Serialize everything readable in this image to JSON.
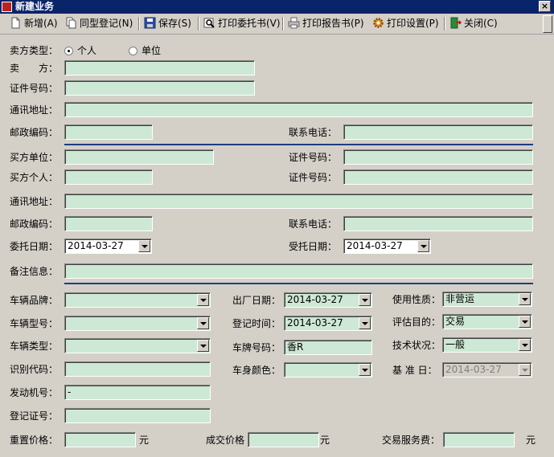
{
  "window": {
    "title": "新建业务"
  },
  "toolbar": {
    "add": "新增(A)",
    "same_register": "同型登记(N)",
    "save": "保存(S)",
    "print_commission": "打印委托书(V)",
    "print_report": "打印报告书(P)",
    "print_settings": "打印设置(P)",
    "close": "关闭(C)"
  },
  "seller": {
    "type_label": "卖方类型：",
    "type_options": [
      "个人",
      "单位"
    ],
    "type_selected": "个人",
    "name_label": "卖　　方：",
    "name_value": "",
    "id_label": "证件号码：",
    "id_value": "",
    "address_label": "通讯地址：",
    "address_value": "",
    "postal_label": "邮政编码：",
    "postal_value": "",
    "phone_label": "联系电话：",
    "phone_value": ""
  },
  "buyer": {
    "unit_label": "买方单位：",
    "unit_value": "",
    "unit_id_label": "证件号码：",
    "unit_id_value": "",
    "person_label": "买方个人：",
    "person_value": "",
    "person_id_label": "证件号码：",
    "person_id_value": "",
    "address_label": "通讯地址：",
    "address_value": "",
    "postal_label": "邮政编码：",
    "postal_value": "",
    "phone_label": "联系电话：",
    "phone_value": "",
    "commission_date_label": "委托日期：",
    "commission_date_value": "2014-03-27",
    "accept_date_label": "受托日期：",
    "accept_date_value": "2014-03-27",
    "remarks_label": "备注信息：",
    "remarks_value": ""
  },
  "vehicle": {
    "brand_label": "车辆品牌：",
    "brand_value": "",
    "factory_date_label": "出厂日期：",
    "factory_date_value": "2014-03-27",
    "usage_label": "使用性质：",
    "usage_value": "非营运",
    "model_label": "车辆型号：",
    "model_value": "",
    "register_time_label": "登记时间：",
    "register_time_value": "2014-03-27",
    "purpose_label": "评估目的：",
    "purpose_value": "交易",
    "type_label": "车辆类型：",
    "type_value": "",
    "plate_label": "车牌号码：",
    "plate_value": "香R",
    "condition_label": "技术状况：",
    "condition_value": "一般",
    "vin_label": "识别代码：",
    "vin_value": "",
    "color_label": "车身颜色：",
    "color_value": "",
    "base_date_label": "基 准 日：",
    "base_date_value": "2014-03-27",
    "engine_label": "发动机号：",
    "engine_value": "-",
    "cert_label": "登记证号：",
    "cert_value": "",
    "reset_price_label": "重置价格：",
    "reset_price_value": "",
    "deal_price_label": "成交价格",
    "deal_price_value": "",
    "service_fee_label": "交易服务费：",
    "service_fee_value": "",
    "unit": "元"
  },
  "colors": {
    "field_bg": "#cde8d4",
    "title_bg": "#0a246a",
    "divider": "#1e3c82"
  }
}
